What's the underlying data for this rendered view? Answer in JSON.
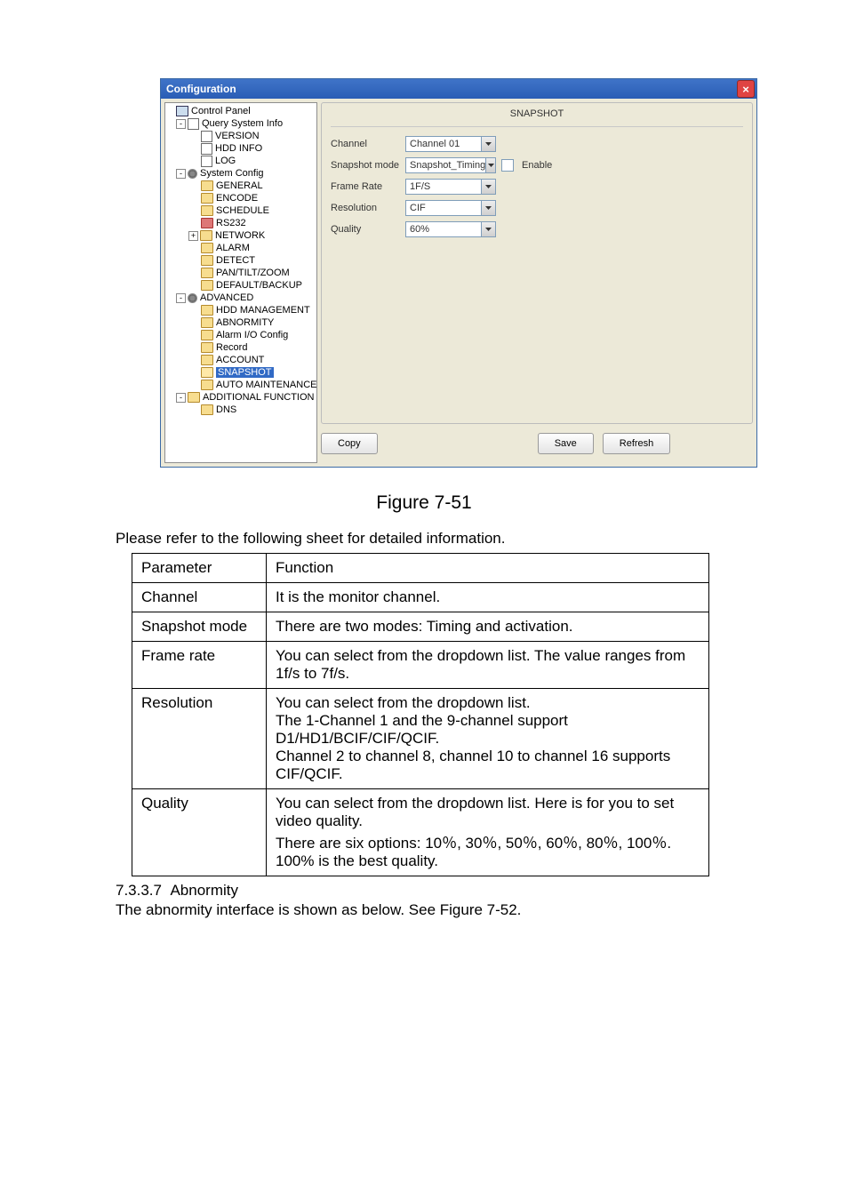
{
  "window": {
    "title": "Configuration",
    "close_glyph": "×"
  },
  "tree": {
    "control_panel": "Control Panel",
    "query_sys_info": "Query System Info",
    "version": "VERSION",
    "hdd_info": "HDD INFO",
    "log": "LOG",
    "system_config": "System Config",
    "general": "GENERAL",
    "encode": "ENCODE",
    "schedule": "SCHEDULE",
    "rs232": "RS232",
    "network": "NETWORK",
    "alarm": "ALARM",
    "detect": "DETECT",
    "ptz": "PAN/TILT/ZOOM",
    "default_backup": "DEFAULT/BACKUP",
    "advanced": "ADVANCED",
    "hdd_management": "HDD MANAGEMENT",
    "abnormity": "ABNORMITY",
    "alarm_io": "Alarm I/O Config",
    "record": "Record",
    "account": "ACCOUNT",
    "snapshot": "SNAPSHOT",
    "auto_maint": "AUTO MAINTENANCE",
    "additional_function": "ADDITIONAL FUNCTION",
    "dns": "DNS"
  },
  "form": {
    "heading": "SNAPSHOT",
    "channel_label": "Channel",
    "channel_value": "Channel 01",
    "snapshot_mode_label": "Snapshot mode",
    "snapshot_mode_value": "Snapshot_Timing",
    "enable_label": "Enable",
    "frame_rate_label": "Frame Rate",
    "frame_rate_value": "1F/S",
    "resolution_label": "Resolution",
    "resolution_value": "CIF",
    "quality_label": "Quality",
    "quality_value": "60%"
  },
  "buttons": {
    "copy": "Copy",
    "save": "Save",
    "refresh": "Refresh"
  },
  "figure_caption": "Figure 7-51",
  "body_text": "Please refer to the following sheet for detailed information.",
  "table": {
    "header": {
      "param": "Parameter",
      "func": "Function"
    },
    "rows": [
      {
        "param": "Channel",
        "func": "It is the monitor channel."
      },
      {
        "param": "Snapshot mode",
        "func": "There are two modes: Timing and activation."
      },
      {
        "param": "Frame rate",
        "func": "You can select from the dropdown list. The value ranges from 1f/s to 7f/s."
      },
      {
        "param": "Resolution",
        "func": "You can select from the dropdown list.\nThe 1-Channel 1 and the 9-channel support D1/HD1/BCIF/CIF/QCIF.\nChannel 2 to channel 8, channel 10 to channel 16 supports CIF/QCIF."
      },
      {
        "param": "Quality",
        "func": "You can select from the dropdown list. Here is for you to set video quality.\nThere are six options: 10％, 30％, 50％, 60％, 80％, 100％. 100% is the best quality."
      }
    ]
  },
  "section": {
    "num": "7.3.3.7",
    "title": "Abnormity",
    "body": "The abnormity interface is shown as below. See Figure 7-52."
  }
}
